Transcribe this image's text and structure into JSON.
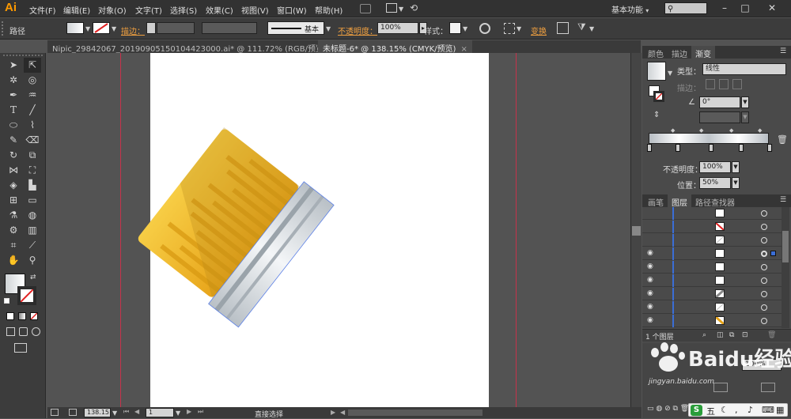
{
  "app": {
    "logo": "Ai",
    "workspace": "基本功能",
    "workspace_arrow": "▾"
  },
  "menu": [
    "文件(F)",
    "编辑(E)",
    "对象(O)",
    "文字(T)",
    "选择(S)",
    "效果(C)",
    "视图(V)",
    "窗口(W)",
    "帮助(H)"
  ],
  "control_bar": {
    "selection_label": "路径",
    "stroke_label": "描边：",
    "brush_label": "基本",
    "opacity_label": "不透明度：",
    "opacity_value": "100%",
    "style_label": "样式：",
    "transform_label": "变换"
  },
  "tabs": [
    {
      "label": "Nipic_29842067_20190905150104423000.ai* @ 111.72% (RGB/预览)",
      "close": "×"
    },
    {
      "label": "未标题-6* @ 138.15% (CMYK/预览)",
      "close": "×"
    }
  ],
  "status": {
    "zoom": "138.15",
    "page": "1",
    "tool_name": "直接选择"
  },
  "gradient_panel": {
    "tabs": [
      "颜色",
      "描边",
      "渐变"
    ],
    "type_label": "类型：",
    "type_value": "线性",
    "stroke_label": "描边：",
    "angle_value": "0°",
    "opacity_label": "不透明度：",
    "opacity_value": "100%",
    "location_label": "位置：",
    "location_value": "50%"
  },
  "layers_panel": {
    "tabs": [
      "画笔",
      "图层",
      "路径查找器"
    ],
    "footer_label": "1 个图层",
    "rows": [
      {
        "eye": false,
        "thumb": "white",
        "target": false
      },
      {
        "eye": false,
        "thumb": "red-slash",
        "target": false
      },
      {
        "eye": false,
        "thumb": "white-line",
        "target": false
      },
      {
        "eye": true,
        "thumb": "white",
        "target": true
      },
      {
        "eye": true,
        "thumb": "white",
        "target": false
      },
      {
        "eye": true,
        "thumb": "white",
        "target": false
      },
      {
        "eye": true,
        "thumb": "grey-slash",
        "target": false
      },
      {
        "eye": true,
        "thumb": "white-line",
        "target": false
      },
      {
        "eye": true,
        "thumb": "orange-slash",
        "target": false
      }
    ]
  },
  "bottom_panel": {
    "opacity_value": "100%"
  },
  "watermark": {
    "brand": "Baidu经验",
    "url": "jingyan.baidu.com"
  },
  "taskbar": {
    "ime": "五"
  },
  "colors": {
    "accent": "#ff9a00",
    "guide": "#c6324b",
    "gold": "#f1bd2f",
    "gold_dark": "#d99a12",
    "silver": "#c8ced4",
    "layer_blue": "#3b6ed6"
  }
}
